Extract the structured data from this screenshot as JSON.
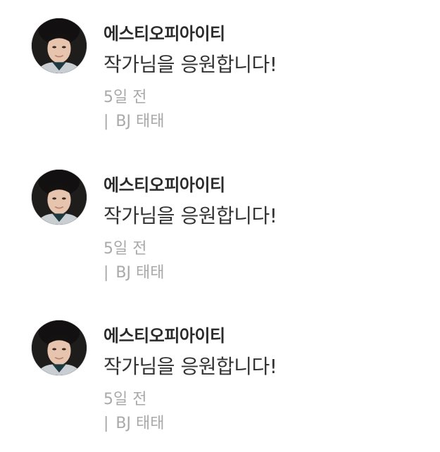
{
  "comments": [
    {
      "author": "에스티오피아이티",
      "message": "작가님을 응원합니다!",
      "time": "5일 전",
      "source_divider": "|",
      "source": "BJ 태태",
      "avatar_icon": "profile-photo"
    },
    {
      "author": "에스티오피아이티",
      "message": "작가님을 응원합니다!",
      "time": "5일 전",
      "source_divider": "|",
      "source": "BJ 태태",
      "avatar_icon": "profile-photo"
    },
    {
      "author": "에스티오피아이티",
      "message": "작가님을 응원합니다!",
      "time": "5일 전",
      "source_divider": "|",
      "source": "BJ 태태",
      "avatar_icon": "profile-photo"
    }
  ],
  "colors": {
    "author": "#2b2b2b",
    "message": "#333333",
    "meta": "#a9a9a9",
    "background": "#ffffff"
  }
}
